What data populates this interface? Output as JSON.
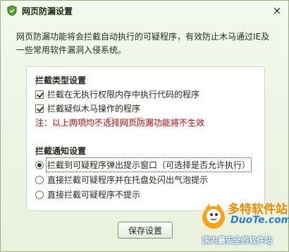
{
  "window": {
    "title": "网页防漏设置",
    "close_glyph": "×"
  },
  "description": "网页防漏功能将会拦截自动执行的可疑程序，有效防止木马通过IE及一些常用软件漏洞入侵系统。",
  "intercept_type": {
    "title": "拦截类型设置",
    "options": [
      {
        "label": "拦截在无执行权限内存中执行代码的程序",
        "checked": true
      },
      {
        "label": "拦截疑似木马操作的程序",
        "checked": true
      }
    ],
    "warning": "注：以上两项均不选择网页防漏功能将不生效"
  },
  "notify": {
    "title": "拦截通知设置",
    "options": [
      {
        "label": "拦截到可疑程序弹出提示窗口（可选择是否允许执行）",
        "selected": true
      },
      {
        "label": "直接拦截可疑程序并在托盘处闪出气泡提示",
        "selected": false
      },
      {
        "label": "直接拦截可疑程序不提示",
        "selected": false
      }
    ]
  },
  "save_button": "保存设置",
  "watermark": "www.DuoTe.com",
  "brand": {
    "name": "多特软件站",
    "domain": "DuoTe.com",
    "slogan": "国内最安全的软件站"
  },
  "colors": {
    "accent": "#6a9a2a",
    "warning": "#d20000",
    "brand_orange": "#f08a00",
    "brand_blue": "#2c7fc6"
  }
}
